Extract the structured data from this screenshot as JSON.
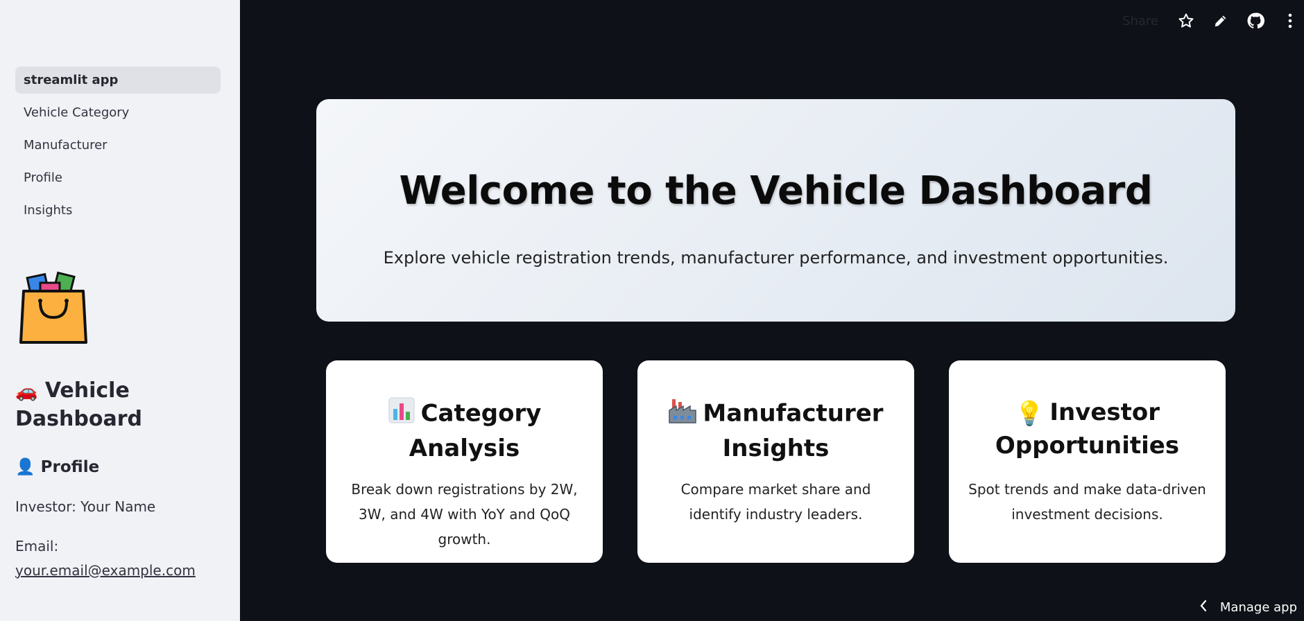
{
  "sidebar": {
    "nav": [
      {
        "label": "streamlit app",
        "active": true
      },
      {
        "label": "Vehicle Category"
      },
      {
        "label": "Manufacturer"
      },
      {
        "label": "Profile"
      },
      {
        "label": "Insights"
      }
    ],
    "logo_icon": "shopping-bag-icon",
    "title_emoji": "🚗",
    "title": "Vehicle Dashboard",
    "profile_emoji": "👤",
    "profile_heading": "Profile",
    "investor": "Investor: Your Name",
    "email_label": "Email:",
    "email": "your.email@example.com"
  },
  "toolbar": {
    "share_label": "Share",
    "icons": [
      "star-icon",
      "pencil-icon",
      "github-icon",
      "more-vertical-icon"
    ]
  },
  "hero": {
    "title": "Welcome to the Vehicle Dashboard",
    "subtitle": "Explore vehicle registration trends, manufacturer performance, and investment opportunities."
  },
  "cards": [
    {
      "icon": "bar-chart-icon",
      "title": "Category Analysis",
      "desc": "Break down registrations by 2W, 3W, and 4W with YoY and QoQ growth."
    },
    {
      "icon": "factory-icon",
      "title": "Manufacturer Insights",
      "desc": "Compare market share and identify industry leaders."
    },
    {
      "emoji": "💡",
      "title": "Investor Opportunities",
      "desc": "Spot trends and make data-driven investment decisions."
    }
  ],
  "footer": {
    "manage_label": "Manage app"
  },
  "colors": {
    "main_bg": "#0e1117",
    "sidebar_bg": "#f0f2f6",
    "card_bg": "#ffffff"
  }
}
